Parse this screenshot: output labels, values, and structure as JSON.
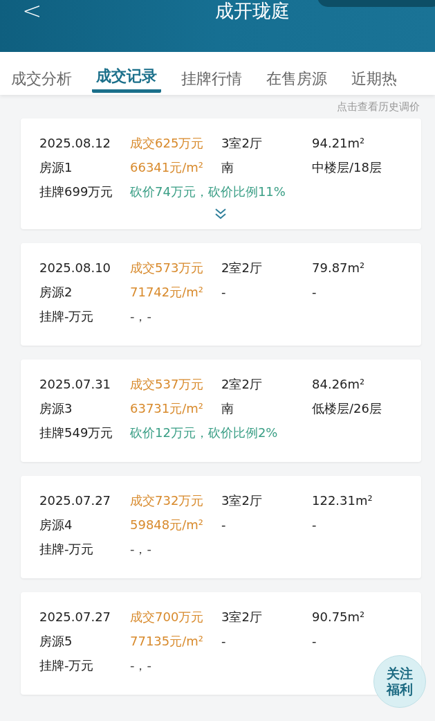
{
  "header": {
    "back": "<",
    "title": "成开珑庭"
  },
  "tabs": [
    {
      "label": "成交分析",
      "selected": false
    },
    {
      "label": "成交记录",
      "selected": true
    },
    {
      "label": "挂牌行情",
      "selected": false
    },
    {
      "label": "在售房源",
      "selected": false
    },
    {
      "label": "近期热",
      "selected": false
    }
  ],
  "hint": "点击查看历史调价",
  "records": [
    {
      "date": "2025.08.12",
      "price": "成交625万元",
      "layout": "3室2厅",
      "area": "94.21m²",
      "source": "房源1",
      "unit_price": "66341元/m²",
      "orientation": "南",
      "floor": "中楼层/18层",
      "listing": "挂牌699万元",
      "discount": "砍价74万元，砍价比例11%",
      "kind": "cut",
      "expanded": false
    },
    {
      "date": "2025.08.10",
      "price": "成交573万元",
      "layout": "2室2厅",
      "area": "79.87m²",
      "source": "房源2",
      "unit_price": "71742元/m²",
      "orientation": "-",
      "floor": "-",
      "listing": "挂牌-万元",
      "discount": "-，-",
      "kind": "none"
    },
    {
      "date": "2025.07.31",
      "price": "成交537万元",
      "layout": "2室2厅",
      "area": "84.26m²",
      "source": "房源3",
      "unit_price": "63731元/m²",
      "orientation": "南",
      "floor": "低楼层/26层",
      "listing": "挂牌549万元",
      "discount": "砍价12万元，砍价比例2%",
      "kind": "cut"
    },
    {
      "date": "2025.07.27",
      "price": "成交732万元",
      "layout": "3室2厅",
      "area": "122.31m²",
      "source": "房源4",
      "unit_price": "59848元/m²",
      "orientation": "-",
      "floor": "-",
      "listing": "挂牌-万元",
      "discount": "-，-",
      "kind": "none"
    },
    {
      "date": "2025.07.27",
      "price": "成交700万元",
      "layout": "3室2厅",
      "area": "90.75m²",
      "source": "房源5",
      "unit_price": "77135元/m²",
      "orientation": "-",
      "floor": "-",
      "listing": "挂牌-万元",
      "discount": "-，-",
      "kind": "none"
    }
  ],
  "float_badge": {
    "lines": [
      "关注",
      "福利"
    ]
  }
}
